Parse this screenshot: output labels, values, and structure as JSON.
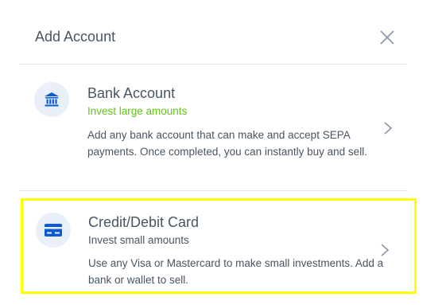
{
  "header": {
    "title": "Add Account",
    "close_icon": "close-icon"
  },
  "options": [
    {
      "title": "Bank Account",
      "subtitle": "Invest large amounts",
      "description": "Add any bank account that can make and accept SEPA payments. Once completed, you can instantly buy and sell.",
      "icon": "bank-icon",
      "subtitle_color": "#61c416"
    },
    {
      "title": "Credit/Debit Card",
      "subtitle": "Invest small amounts",
      "description": "Use any Visa or Mastercard to make small investments. Add a bank or wallet to sell.",
      "icon": "credit-card-icon",
      "highlight_color": "#ffff00"
    }
  ],
  "colors": {
    "text": "#485563",
    "icon": "#0a5bd3",
    "icon_bg": "#eaf0f9",
    "divider": "#dfe3e8"
  }
}
